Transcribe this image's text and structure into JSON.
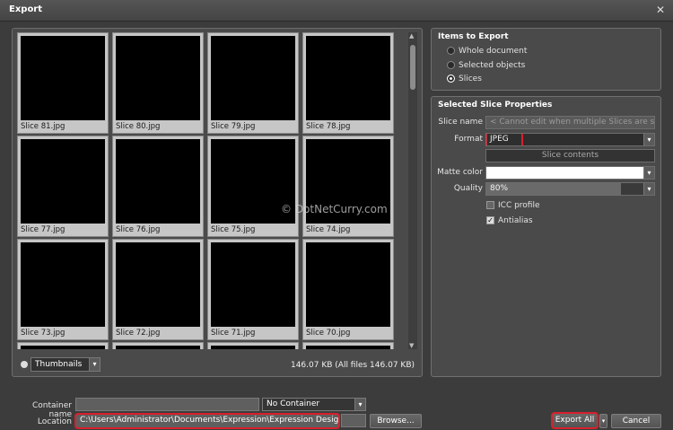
{
  "window": {
    "title": "Export",
    "close_glyph": "✕"
  },
  "gallery": {
    "thumbnails": [
      "Slice 81.jpg",
      "Slice 80.jpg",
      "Slice 79.jpg",
      "Slice 78.jpg",
      "Slice 77.jpg",
      "Slice 76.jpg",
      "Slice 75.jpg",
      "Slice 74.jpg",
      "Slice 73.jpg",
      "Slice 72.jpg",
      "Slice 71.jpg",
      "Slice 70.jpg"
    ],
    "view_mode": "Thumbnails",
    "size_summary": "146.07 KB (All files 146.07 KB)"
  },
  "items_to_export": {
    "title": "Items to Export",
    "options": [
      "Whole document",
      "Selected objects",
      "Slices"
    ],
    "selected": "Slices"
  },
  "slice_props": {
    "title": "Selected Slice Properties",
    "slice_name_label": "Slice name",
    "slice_name_value": "< Cannot edit when multiple Slices are selec...",
    "format_label": "Format",
    "format_value": "JPEG",
    "slice_contents_label": "Slice contents",
    "matte_label": "Matte color",
    "matte_color": "#ffffff",
    "quality_label": "Quality",
    "quality_value": "80%",
    "quality_fraction": 0.8,
    "icc_label": "ICC profile",
    "icc_checked": false,
    "antialias_label": "Antialias",
    "antialias_checked": true
  },
  "bottom": {
    "container_name_label": "Container name",
    "container_name_value": "",
    "container_select": "No Container",
    "location_label": "Location",
    "location_value": "C:\\Users\\Administrator\\Documents\\Expression\\Expression Design",
    "browse_label": "Browse...",
    "export_all_label": "Export All",
    "cancel_label": "Cancel"
  },
  "watermark": "© DotNetCurry.com"
}
